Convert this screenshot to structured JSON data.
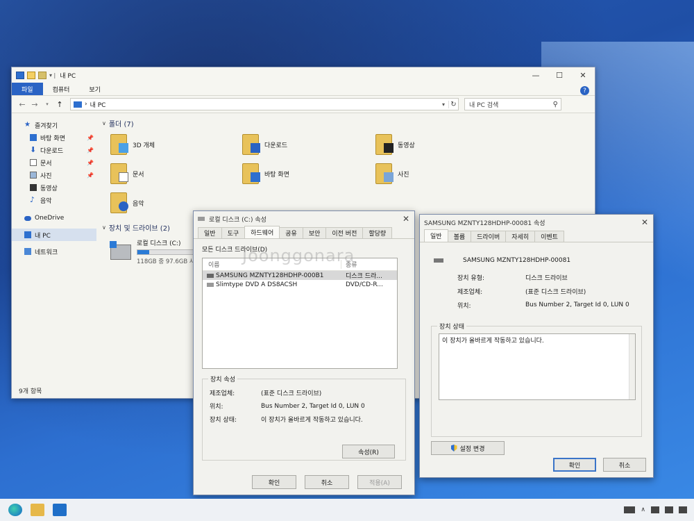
{
  "explorer": {
    "title": "내 PC",
    "ribbon_tabs": [
      "파일",
      "컴퓨터",
      "보기"
    ],
    "address": "내 PC",
    "search_placeholder": "내 PC 검색",
    "nav": {
      "quick_access": "즐겨찾기",
      "items": [
        "바탕 화면",
        "다운로드",
        "문서",
        "사진",
        "동영상",
        "음악"
      ],
      "onedrive": "OneDrive",
      "this_pc": "내 PC",
      "network": "네트워크"
    },
    "folders_header": "폴더 (7)",
    "folders": [
      "3D 개체",
      "다운로드",
      "동영상",
      "문서",
      "바탕 화면",
      "사진",
      "음악"
    ],
    "drives_header": "장치 및 드라이브 (2)",
    "drive": {
      "name": "로컬 디스크 (C:)",
      "space": "118GB 중 97.6GB 사",
      "used_fraction": 0.17
    },
    "status": "9개 항목"
  },
  "drive_dialog": {
    "title": "로컬 디스크 (C:) 속성",
    "tabs": [
      "일반",
      "도구",
      "하드웨어",
      "공유",
      "보안",
      "이전 버전",
      "할당량"
    ],
    "list_label": "모든 디스크 드라이브(D)",
    "columns": [
      "이름",
      "종류"
    ],
    "rows": [
      {
        "name": "SAMSUNG MZNTY128HDHP-000B1",
        "type": "디스크 드라..."
      },
      {
        "name": "Slimtype DVD A DS8ACSH",
        "type": "DVD/CD-R..."
      }
    ],
    "group_title": "장치 속성",
    "props": [
      {
        "k": "제조업체:",
        "v": "(표준 디스크 드라이브)"
      },
      {
        "k": "위치:",
        "v": "Bus Number 2, Target Id 0, LUN 0"
      },
      {
        "k": "장치 상태:",
        "v": "이 장치가 올바르게 작동하고 있습니다."
      }
    ],
    "properties_button": "속성(R)",
    "ok": "확인",
    "cancel": "취소",
    "apply": "적용(A)",
    "watermark": "Joonggonara"
  },
  "device_dialog": {
    "title": "SAMSUNG MZNTY128HDHP-00081 속성",
    "tabs": [
      "일반",
      "볼륨",
      "드라이버",
      "자세히",
      "이벤트"
    ],
    "device_name": "SAMSUNG MZNTY128HDHP-00081",
    "props": [
      {
        "k": "장치 유형:",
        "v": "디스크 드라이브"
      },
      {
        "k": "제조업체:",
        "v": "(표준 디스크 드라이브)"
      },
      {
        "k": "위치:",
        "v": "Bus Number 2, Target Id 0, LUN 0"
      }
    ],
    "status_group": "장치 상태",
    "status_text": "이 장치가 올바르게 작동하고 있습니다.",
    "change_settings": "설정 변경",
    "ok": "확인",
    "cancel": "취소"
  }
}
